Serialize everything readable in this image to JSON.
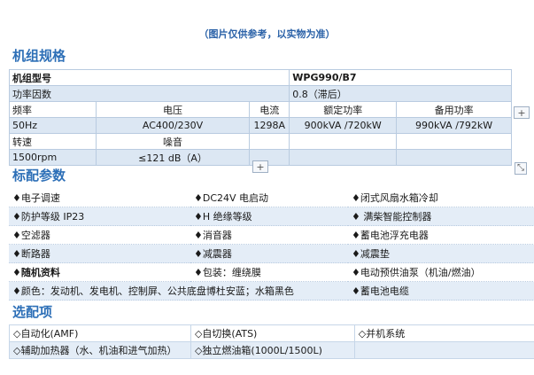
{
  "notice": "（图片仅供参考，以实物为准）",
  "sections": {
    "specs_title": "机组规格",
    "standard_title": "标配参数",
    "optional_title": "选配项"
  },
  "specs": {
    "model_label": "机组型号",
    "model_value": "WPG990/B7",
    "power_factor_label": "功率因数",
    "power_factor_value": "0.8（滞后）",
    "headers": [
      "频率",
      "电压",
      "电流",
      "额定功率",
      "备用功率"
    ],
    "values": [
      "50Hz",
      "AC400/230V",
      "1298A",
      "900kVA /720kW",
      "990kVA /792kW"
    ],
    "speed_label": "转速",
    "noise_label": "噪音",
    "speed_value": "1500rpm",
    "noise_value": "≤121 dB（A）"
  },
  "standard": [
    [
      "♦电子调速",
      "♦DC24V 电启动",
      "♦闭式风扇水箱冷却"
    ],
    [
      "♦防护等级 IP23",
      "♦H 绝缘等级",
      "♦ 满柴智能控制器"
    ],
    [
      "♦空滤器",
      "♦消音器",
      "♦蓄电池浮充电器"
    ],
    [
      "♦断路器",
      "♦减震器",
      "♦减震垫"
    ],
    [
      "♦随机资料",
      "♦包装：缠绕膜",
      "♦电动预供油泵（机油/燃油）"
    ],
    [
      "♦颜色：发动机、发电机、控制屏、公共底盘博杜安蓝；水箱黑色",
      "",
      "♦蓄电池电缆"
    ]
  ],
  "optional": [
    [
      "◇自动化(AMF)",
      "◇自切换(ATS)",
      "◇并机系统"
    ],
    [
      "◇辅助加热器（水、机油和进气加热）",
      "◇独立燃油箱(1000L/1500L)",
      ""
    ]
  ],
  "controls": {
    "plus": "+",
    "resize": "⤡"
  }
}
